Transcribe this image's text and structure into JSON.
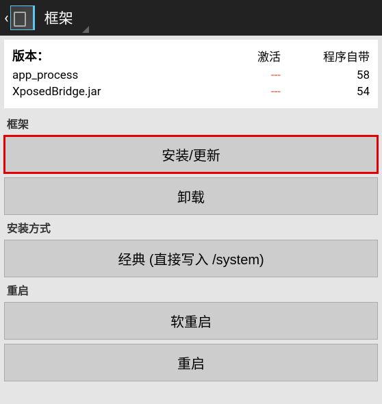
{
  "header": {
    "title": "框架"
  },
  "info": {
    "version_label": "版本：",
    "col_active": "激活",
    "col_bundled": "程序自带",
    "rows": [
      {
        "name": "app_process",
        "active": "---",
        "bundled": "58"
      },
      {
        "name": "XposedBridge.jar",
        "active": "---",
        "bundled": "54"
      }
    ]
  },
  "sections": {
    "framework": {
      "label": "框架",
      "install_update": "安装/更新",
      "uninstall": "卸载"
    },
    "install_method": {
      "label": "安装方式",
      "classic": "经典 (直接写入 /system)"
    },
    "reboot": {
      "label": "重启",
      "soft_reboot": "软重启",
      "reboot": "重启"
    }
  }
}
